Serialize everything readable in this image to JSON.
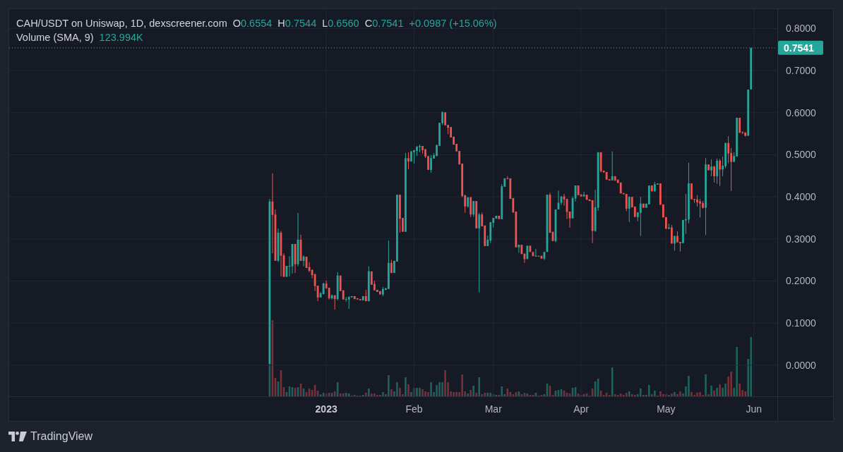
{
  "chart": {
    "legend": {
      "title": "CAH/USDT on Uniswap, 1D, dexscreener.com",
      "ohlc": [
        {
          "label": "O",
          "value": "0.6554"
        },
        {
          "label": "H",
          "value": "0.7544"
        },
        {
          "label": "L",
          "value": "0.6560"
        },
        {
          "label": "C",
          "value": "0.7541"
        }
      ],
      "change": "+0.0987 (+15.06%)"
    },
    "indicator": {
      "name": "Volume (SMA, 9)",
      "value": "123.994K"
    },
    "chart_data": {
      "type": "candlestick",
      "grid": true,
      "x": [
        "2022-12-12",
        "2022-12-13",
        "2022-12-14",
        "2022-12-15",
        "2022-12-16",
        "2022-12-17",
        "2022-12-18",
        "2022-12-19",
        "2022-12-20",
        "2022-12-21",
        "2022-12-22",
        "2022-12-23",
        "2022-12-24",
        "2022-12-25",
        "2022-12-26",
        "2022-12-27",
        "2022-12-28",
        "2022-12-29",
        "2022-12-30",
        "2022-12-31",
        "2023-01-01",
        "2023-01-02",
        "2023-01-03",
        "2023-01-04",
        "2023-01-05",
        "2023-01-06",
        "2023-01-07",
        "2023-01-08",
        "2023-01-09",
        "2023-01-10",
        "2023-01-11",
        "2023-01-12",
        "2023-01-13",
        "2023-01-14",
        "2023-01-15",
        "2023-01-16",
        "2023-01-17",
        "2023-01-18",
        "2023-01-19",
        "2023-01-20",
        "2023-01-21",
        "2023-01-22",
        "2023-01-23",
        "2023-01-24",
        "2023-01-25",
        "2023-01-26",
        "2023-01-27",
        "2023-01-28",
        "2023-01-29",
        "2023-01-30",
        "2023-01-31",
        "2023-02-01",
        "2023-02-02",
        "2023-02-03",
        "2023-02-04",
        "2023-02-05",
        "2023-02-06",
        "2023-02-07",
        "2023-02-08",
        "2023-02-09",
        "2023-02-10",
        "2023-02-11",
        "2023-02-12",
        "2023-02-13",
        "2023-02-14",
        "2023-02-15",
        "2023-02-16",
        "2023-02-17",
        "2023-02-18",
        "2023-02-19",
        "2023-02-20",
        "2023-02-21",
        "2023-02-22",
        "2023-02-23",
        "2023-02-24",
        "2023-02-25",
        "2023-02-26",
        "2023-02-27",
        "2023-02-28",
        "2023-03-01",
        "2023-03-02",
        "2023-03-03",
        "2023-03-04",
        "2023-03-05",
        "2023-03-06",
        "2023-03-07",
        "2023-03-08",
        "2023-03-09",
        "2023-03-10",
        "2023-03-11",
        "2023-03-12",
        "2023-03-13",
        "2023-03-14",
        "2023-03-15",
        "2023-03-16",
        "2023-03-17",
        "2023-03-18",
        "2023-03-19",
        "2023-03-20",
        "2023-03-21",
        "2023-03-22",
        "2023-03-23",
        "2023-03-24",
        "2023-03-25",
        "2023-03-26",
        "2023-03-27",
        "2023-03-28",
        "2023-03-29",
        "2023-03-30",
        "2023-03-31",
        "2023-04-01",
        "2023-04-02",
        "2023-04-03",
        "2023-04-04",
        "2023-04-05",
        "2023-04-06",
        "2023-04-07",
        "2023-04-08",
        "2023-04-09",
        "2023-04-10",
        "2023-04-11",
        "2023-04-12",
        "2023-04-13",
        "2023-04-14",
        "2023-04-15",
        "2023-04-16",
        "2023-04-17",
        "2023-04-18",
        "2023-04-19",
        "2023-04-20",
        "2023-04-21",
        "2023-04-22",
        "2023-04-23",
        "2023-04-24",
        "2023-04-25",
        "2023-04-26",
        "2023-04-27",
        "2023-04-28",
        "2023-04-29",
        "2023-04-30",
        "2023-05-01",
        "2023-05-02",
        "2023-05-03",
        "2023-05-04",
        "2023-05-05",
        "2023-05-06",
        "2023-05-07",
        "2023-05-08",
        "2023-05-09",
        "2023-05-10",
        "2023-05-11",
        "2023-05-12",
        "2023-05-13",
        "2023-05-14",
        "2023-05-15",
        "2023-05-16",
        "2023-05-17",
        "2023-05-18",
        "2023-05-19",
        "2023-05-20",
        "2023-05-21",
        "2023-05-22",
        "2023-05-23",
        "2023-05-24",
        "2023-05-25",
        "2023-05-26",
        "2023-05-27",
        "2023-05-28",
        "2023-05-29",
        "2023-05-30",
        "2023-05-31"
      ],
      "ohlc": [
        [
          0.003,
          0.395,
          0.003,
          0.389
        ],
        [
          0.389,
          0.456,
          0.266,
          0.357
        ],
        [
          0.358,
          0.37,
          0.248,
          0.248
        ],
        [
          0.248,
          0.325,
          0.245,
          0.315
        ],
        [
          0.315,
          0.319,
          0.211,
          0.26
        ],
        [
          0.261,
          0.266,
          0.21,
          0.21
        ],
        [
          0.21,
          0.236,
          0.21,
          0.236
        ],
        [
          0.235,
          0.259,
          0.211,
          0.236
        ],
        [
          0.235,
          0.288,
          0.218,
          0.288
        ],
        [
          0.288,
          0.288,
          0.219,
          0.24
        ],
        [
          0.24,
          0.362,
          0.235,
          0.298
        ],
        [
          0.298,
          0.31,
          0.248,
          0.248
        ],
        [
          0.248,
          0.261,
          0.235,
          0.258
        ],
        [
          0.258,
          0.258,
          0.231,
          0.231
        ],
        [
          0.233,
          0.245,
          0.221,
          0.224
        ],
        [
          0.226,
          0.228,
          0.206,
          0.214
        ],
        [
          0.216,
          0.218,
          0.176,
          0.188
        ],
        [
          0.189,
          0.189,
          0.152,
          0.161
        ],
        [
          0.161,
          0.174,
          0.161,
          0.171
        ],
        [
          0.169,
          0.196,
          0.168,
          0.194
        ],
        [
          0.194,
          0.201,
          0.181,
          0.183
        ],
        [
          0.184,
          0.184,
          0.156,
          0.159
        ],
        [
          0.159,
          0.168,
          0.156,
          0.166
        ],
        [
          0.166,
          0.166,
          0.132,
          0.157
        ],
        [
          0.157,
          0.221,
          0.154,
          0.213
        ],
        [
          0.213,
          0.213,
          0.176,
          0.176
        ],
        [
          0.178,
          0.178,
          0.156,
          0.156
        ],
        [
          0.156,
          0.162,
          0.151,
          0.157
        ],
        [
          0.156,
          0.164,
          0.134,
          0.162
        ],
        [
          0.161,
          0.164,
          0.161,
          0.164
        ],
        [
          0.164,
          0.164,
          0.157,
          0.157
        ],
        [
          0.159,
          0.159,
          0.156,
          0.156
        ],
        [
          0.157,
          0.157,
          0.154,
          0.154
        ],
        [
          0.154,
          0.164,
          0.154,
          0.164
        ],
        [
          0.164,
          0.179,
          0.152,
          0.152
        ],
        [
          0.152,
          0.235,
          0.152,
          0.223
        ],
        [
          0.223,
          0.223,
          0.191,
          0.191
        ],
        [
          0.193,
          0.201,
          0.178,
          0.178
        ],
        [
          0.179,
          0.179,
          0.174,
          0.174
        ],
        [
          0.176,
          0.176,
          0.168,
          0.168
        ],
        [
          0.168,
          0.186,
          0.164,
          0.181
        ],
        [
          0.179,
          0.183,
          0.178,
          0.183
        ],
        [
          0.181,
          0.296,
          0.181,
          0.243
        ],
        [
          0.243,
          0.25,
          0.219,
          0.219
        ],
        [
          0.219,
          0.248,
          0.219,
          0.248
        ],
        [
          0.246,
          0.405,
          0.246,
          0.405
        ],
        [
          0.405,
          0.405,
          0.315,
          0.348
        ],
        [
          0.35,
          0.35,
          0.317,
          0.317
        ],
        [
          0.317,
          0.504,
          0.317,
          0.492
        ],
        [
          0.492,
          0.506,
          0.466,
          0.484
        ],
        [
          0.484,
          0.509,
          0.484,
          0.508
        ],
        [
          0.506,
          0.511,
          0.479,
          0.511
        ],
        [
          0.509,
          0.521,
          0.497,
          0.519
        ],
        [
          0.518,
          0.524,
          0.506,
          0.521
        ],
        [
          0.521,
          0.521,
          0.503,
          0.511
        ],
        [
          0.513,
          0.514,
          0.492,
          0.496
        ],
        [
          0.497,
          0.497,
          0.464,
          0.464
        ],
        [
          0.464,
          0.499,
          0.457,
          0.492
        ],
        [
          0.491,
          0.504,
          0.491,
          0.499
        ],
        [
          0.497,
          0.524,
          0.497,
          0.523
        ],
        [
          0.521,
          0.576,
          0.521,
          0.576
        ],
        [
          0.575,
          0.603,
          0.571,
          0.601
        ],
        [
          0.601,
          0.601,
          0.57,
          0.57
        ],
        [
          0.571,
          0.571,
          0.549,
          0.564
        ],
        [
          0.566,
          0.566,
          0.541,
          0.541
        ],
        [
          0.543,
          0.543,
          0.524,
          0.524
        ],
        [
          0.526,
          0.526,
          0.508,
          0.508
        ],
        [
          0.509,
          0.509,
          0.477,
          0.477
        ],
        [
          0.479,
          0.479,
          0.399,
          0.402
        ],
        [
          0.404,
          0.404,
          0.362,
          0.377
        ],
        [
          0.377,
          0.399,
          0.374,
          0.399
        ],
        [
          0.399,
          0.399,
          0.352,
          0.358
        ],
        [
          0.358,
          0.39,
          0.353,
          0.39
        ],
        [
          0.39,
          0.39,
          0.325,
          0.325
        ],
        [
          0.325,
          0.362,
          0.173,
          0.358
        ],
        [
          0.358,
          0.363,
          0.33,
          0.33
        ],
        [
          0.332,
          0.332,
          0.283,
          0.283
        ],
        [
          0.283,
          0.308,
          0.283,
          0.298
        ],
        [
          0.296,
          0.34,
          0.29,
          0.34
        ],
        [
          0.338,
          0.35,
          0.327,
          0.35
        ],
        [
          0.348,
          0.355,
          0.348,
          0.355
        ],
        [
          0.355,
          0.355,
          0.347,
          0.347
        ],
        [
          0.347,
          0.43,
          0.347,
          0.425
        ],
        [
          0.424,
          0.444,
          0.424,
          0.444
        ],
        [
          0.444,
          0.449,
          0.442,
          0.442
        ],
        [
          0.444,
          0.444,
          0.395,
          0.395
        ],
        [
          0.397,
          0.397,
          0.362,
          0.363
        ],
        [
          0.365,
          0.365,
          0.28,
          0.28
        ],
        [
          0.28,
          0.286,
          0.267,
          0.286
        ],
        [
          0.286,
          0.286,
          0.264,
          0.264
        ],
        [
          0.265,
          0.265,
          0.243,
          0.252
        ],
        [
          0.252,
          0.284,
          0.252,
          0.284
        ],
        [
          0.284,
          0.284,
          0.269,
          0.269
        ],
        [
          0.269,
          0.269,
          0.259,
          0.259
        ],
        [
          0.258,
          0.276,
          0.258,
          0.26
        ],
        [
          0.26,
          0.26,
          0.258,
          0.258
        ],
        [
          0.26,
          0.26,
          0.253,
          0.253
        ],
        [
          0.253,
          0.269,
          0.25,
          0.269
        ],
        [
          0.269,
          0.405,
          0.269,
          0.405
        ],
        [
          0.405,
          0.41,
          0.314,
          0.315
        ],
        [
          0.317,
          0.317,
          0.295,
          0.295
        ],
        [
          0.295,
          0.37,
          0.292,
          0.37
        ],
        [
          0.37,
          0.415,
          0.37,
          0.386
        ],
        [
          0.386,
          0.401,
          0.381,
          0.401
        ],
        [
          0.401,
          0.407,
          0.379,
          0.394
        ],
        [
          0.395,
          0.395,
          0.347,
          0.364
        ],
        [
          0.365,
          0.365,
          0.327,
          0.349
        ],
        [
          0.349,
          0.401,
          0.349,
          0.397
        ],
        [
          0.396,
          0.427,
          0.389,
          0.427
        ],
        [
          0.427,
          0.427,
          0.404,
          0.404
        ],
        [
          0.405,
          0.407,
          0.401,
          0.401
        ],
        [
          0.401,
          0.412,
          0.401,
          0.405
        ],
        [
          0.405,
          0.405,
          0.393,
          0.393
        ],
        [
          0.394,
          0.394,
          0.39,
          0.39
        ],
        [
          0.392,
          0.392,
          0.29,
          0.319
        ],
        [
          0.319,
          0.417,
          0.317,
          0.375
        ],
        [
          0.374,
          0.506,
          0.367,
          0.506
        ],
        [
          0.506,
          0.506,
          0.458,
          0.461
        ],
        [
          0.462,
          0.462,
          0.458,
          0.458
        ],
        [
          0.459,
          0.459,
          0.441,
          0.441
        ],
        [
          0.442,
          0.442,
          0.439,
          0.439
        ],
        [
          0.439,
          0.508,
          0.439,
          0.449
        ],
        [
          0.449,
          0.449,
          0.438,
          0.439
        ],
        [
          0.441,
          0.441,
          0.433,
          0.433
        ],
        [
          0.434,
          0.434,
          0.408,
          0.408
        ],
        [
          0.409,
          0.409,
          0.406,
          0.406
        ],
        [
          0.407,
          0.407,
          0.366,
          0.372
        ],
        [
          0.372,
          0.401,
          0.34,
          0.4
        ],
        [
          0.4,
          0.4,
          0.375,
          0.375
        ],
        [
          0.377,
          0.377,
          0.352,
          0.352
        ],
        [
          0.352,
          0.363,
          0.342,
          0.363
        ],
        [
          0.362,
          0.4,
          0.307,
          0.384
        ],
        [
          0.384,
          0.384,
          0.374,
          0.374
        ],
        [
          0.374,
          0.384,
          0.374,
          0.384
        ],
        [
          0.382,
          0.427,
          0.382,
          0.427
        ],
        [
          0.427,
          0.427,
          0.413,
          0.413
        ],
        [
          0.413,
          0.436,
          0.413,
          0.43
        ],
        [
          0.429,
          0.432,
          0.429,
          0.432
        ],
        [
          0.432,
          0.432,
          0.381,
          0.381
        ],
        [
          0.382,
          0.382,
          0.351,
          0.351
        ],
        [
          0.352,
          0.352,
          0.324,
          0.324
        ],
        [
          0.324,
          0.336,
          0.324,
          0.327
        ],
        [
          0.327,
          0.333,
          0.289,
          0.289
        ],
        [
          0.289,
          0.307,
          0.272,
          0.307
        ],
        [
          0.307,
          0.318,
          0.292,
          0.292
        ],
        [
          0.293,
          0.293,
          0.27,
          0.29
        ],
        [
          0.29,
          0.345,
          0.29,
          0.345
        ],
        [
          0.344,
          0.407,
          0.312,
          0.347
        ],
        [
          0.346,
          0.481,
          0.337,
          0.432
        ],
        [
          0.432,
          0.432,
          0.394,
          0.394
        ],
        [
          0.395,
          0.395,
          0.386,
          0.393
        ],
        [
          0.394,
          0.404,
          0.377,
          0.387
        ],
        [
          0.389,
          0.395,
          0.351,
          0.384
        ],
        [
          0.385,
          0.39,
          0.372,
          0.374
        ],
        [
          0.374,
          0.492,
          0.309,
          0.477
        ],
        [
          0.477,
          0.477,
          0.463,
          0.463
        ],
        [
          0.463,
          0.489,
          0.449,
          0.472
        ],
        [
          0.472,
          0.474,
          0.434,
          0.449
        ],
        [
          0.449,
          0.491,
          0.431,
          0.486
        ],
        [
          0.486,
          0.49,
          0.426,
          0.465
        ],
        [
          0.465,
          0.496,
          0.449,
          0.474
        ],
        [
          0.473,
          0.529,
          0.468,
          0.528
        ],
        [
          0.528,
          0.544,
          0.48,
          0.503
        ],
        [
          0.504,
          0.516,
          0.414,
          0.483
        ],
        [
          0.483,
          0.506,
          0.483,
          0.497
        ],
        [
          0.496,
          0.588,
          0.496,
          0.588
        ],
        [
          0.588,
          0.588,
          0.552,
          0.552
        ],
        [
          0.553,
          0.556,
          0.55,
          0.552
        ],
        [
          0.553,
          0.553,
          0.543,
          0.545
        ],
        [
          0.545,
          0.655,
          0.545,
          0.655
        ],
        [
          0.6554,
          0.7544,
          0.6554,
          0.7541
        ]
      ],
      "xlim": [
        "2022-09-11",
        "2023-06-29"
      ],
      "ylim": [
        -0.074,
        0.846
      ],
      "xticks": [
        {
          "value": "2023-01-01",
          "label": "2023"
        },
        {
          "value": "2023-02-01",
          "label": "Feb"
        },
        {
          "value": "2023-03-01",
          "label": "Mar"
        },
        {
          "value": "2023-04-01",
          "label": "Apr"
        },
        {
          "value": "2023-05-01",
          "label": "May"
        },
        {
          "value": "2023-06-01",
          "label": "Jun"
        }
      ],
      "yticks": [
        {
          "value": 0.8,
          "label": "0.8000"
        },
        {
          "value": 0.7,
          "label": "0.7000"
        },
        {
          "value": 0.6,
          "label": "0.6000"
        },
        {
          "value": 0.5,
          "label": "0.5000"
        },
        {
          "value": 0.4,
          "label": "0.4000"
        },
        {
          "value": 0.3,
          "label": "0.3000"
        },
        {
          "value": 0.2,
          "label": "0.2000"
        },
        {
          "value": 0.1,
          "label": "0.1000"
        },
        {
          "value": 0,
          "label": "0.0000"
        }
      ],
      "ref_lines": [
        {
          "axis": "y",
          "value": 0.7541,
          "label": "0.7541"
        }
      ]
    }
  },
  "branding": {
    "name": "TradingView"
  }
}
